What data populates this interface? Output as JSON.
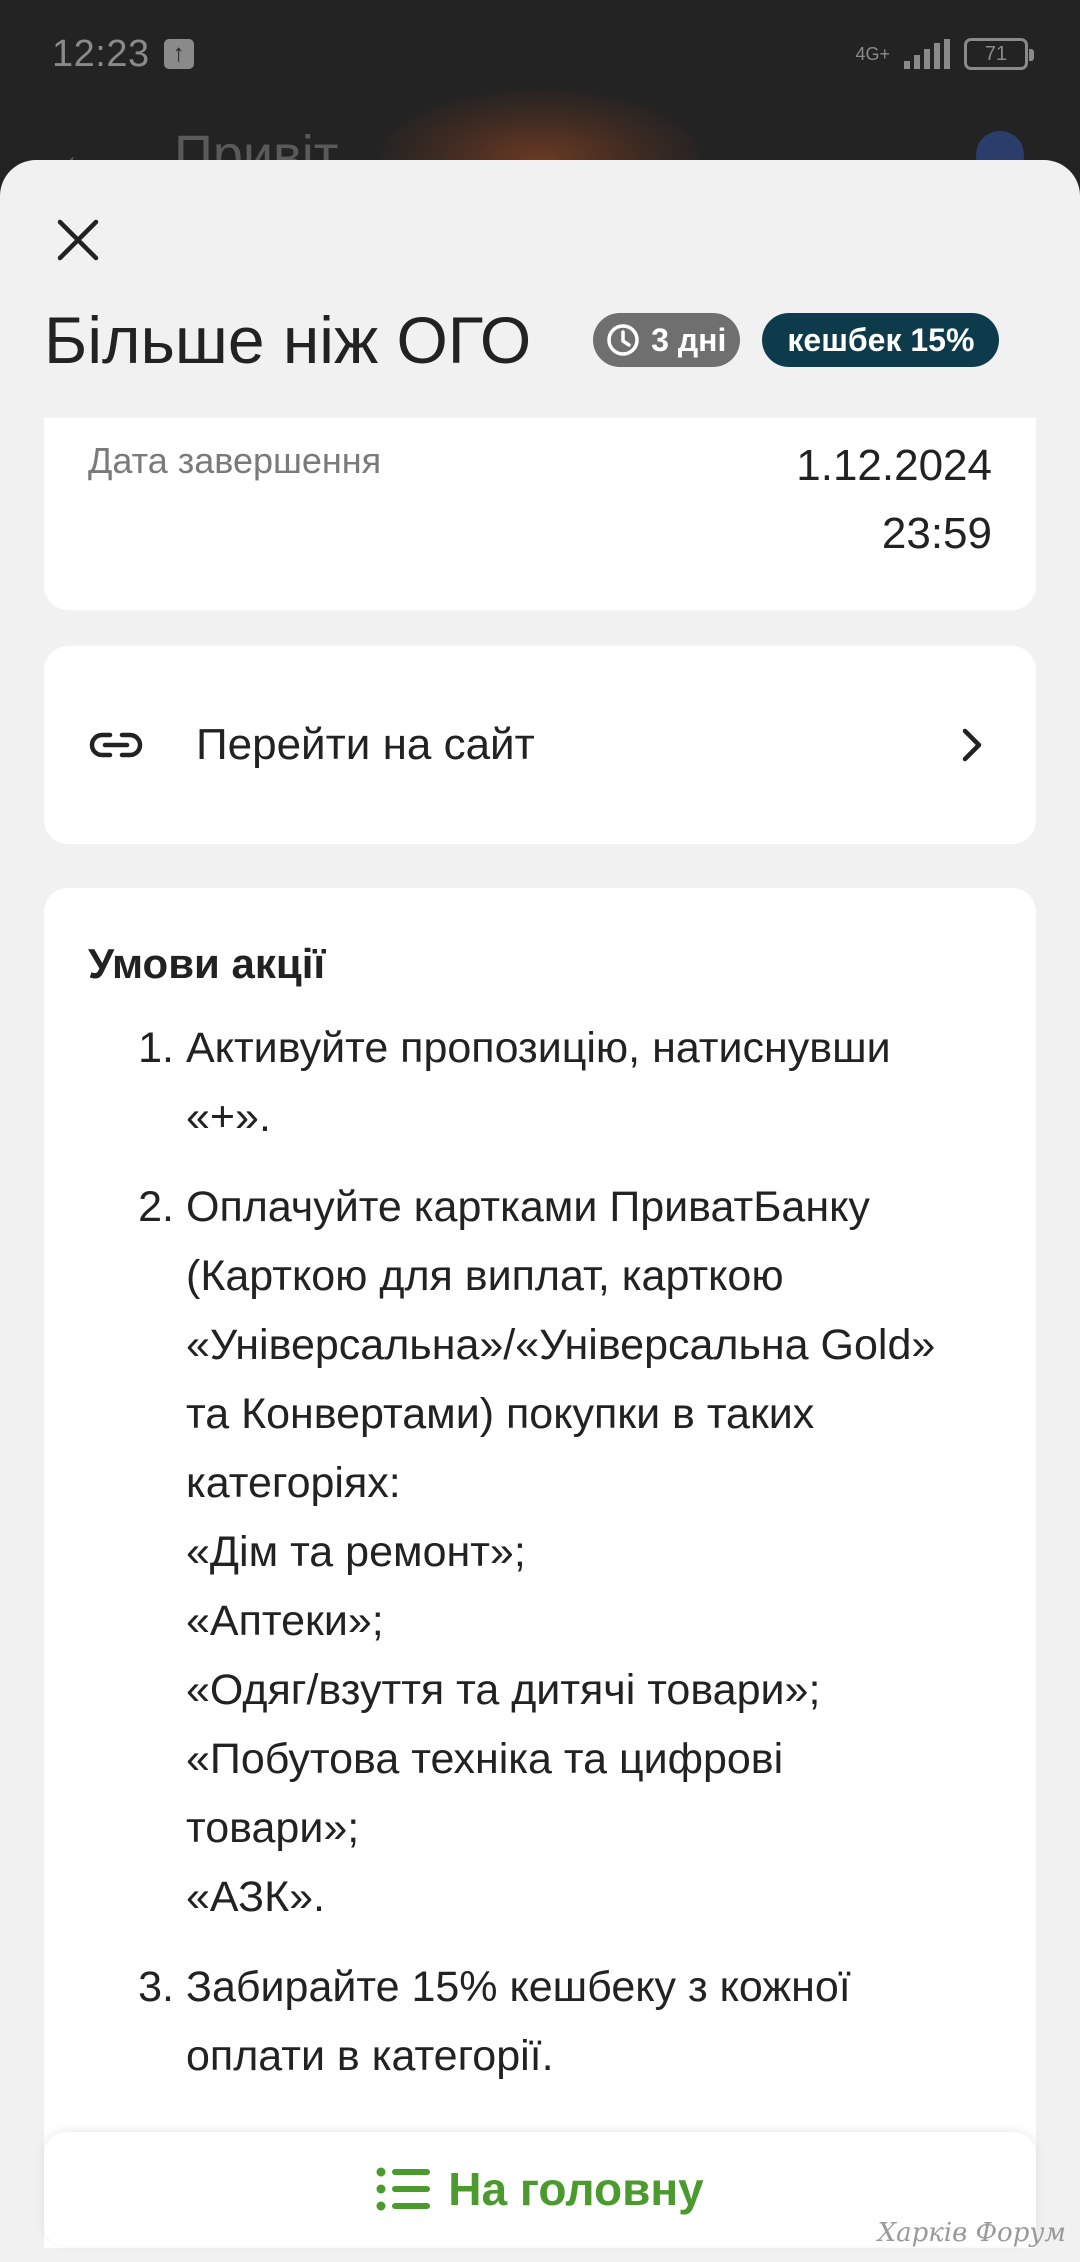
{
  "status_bar": {
    "time": "12:23",
    "network": "4G+",
    "battery": "71"
  },
  "background_app": {
    "title": "Привіт"
  },
  "offer": {
    "title": "Більше ніж ОГО",
    "duration_badge": "3 дні",
    "cashback_badge": "кешбек 15%"
  },
  "dates": {
    "end_label": "Дата завершення",
    "end_date": "1.12.2024",
    "end_time": "23:59"
  },
  "link": {
    "label": "Перейти на сайт"
  },
  "terms": {
    "title": "Умови акції",
    "items": [
      {
        "number": "1.",
        "lines": [
          "Активуйте пропозицію, натиснувши",
          "«+»."
        ]
      },
      {
        "number": "2.",
        "lines": [
          "Оплачуйте картками ПриватБанку",
          "(Карткою для виплат, карткою",
          "«Універсальна»/«Універсальна Gold»",
          "та Конвертами) покупки в таких",
          "категоріях:",
          "«Дім та ремонт»;",
          "«Аптеки»;",
          "«Одяг/взуття та дитячі товари»;",
          "«Побутова техніка та цифрові",
          "товари»;",
          "«АЗК»."
        ]
      },
      {
        "number": "3.",
        "lines": [
          "Забирайте 15% кешбеку з кожної",
          "оплати в категорії."
        ]
      }
    ]
  },
  "home_button": {
    "label": "На головну"
  },
  "watermark": "Харків Форум",
  "colors": {
    "cashback_badge_bg": "#0d3b4c",
    "duration_badge_bg": "#6f6f6f",
    "home_button_text": "#4a9a2e"
  }
}
